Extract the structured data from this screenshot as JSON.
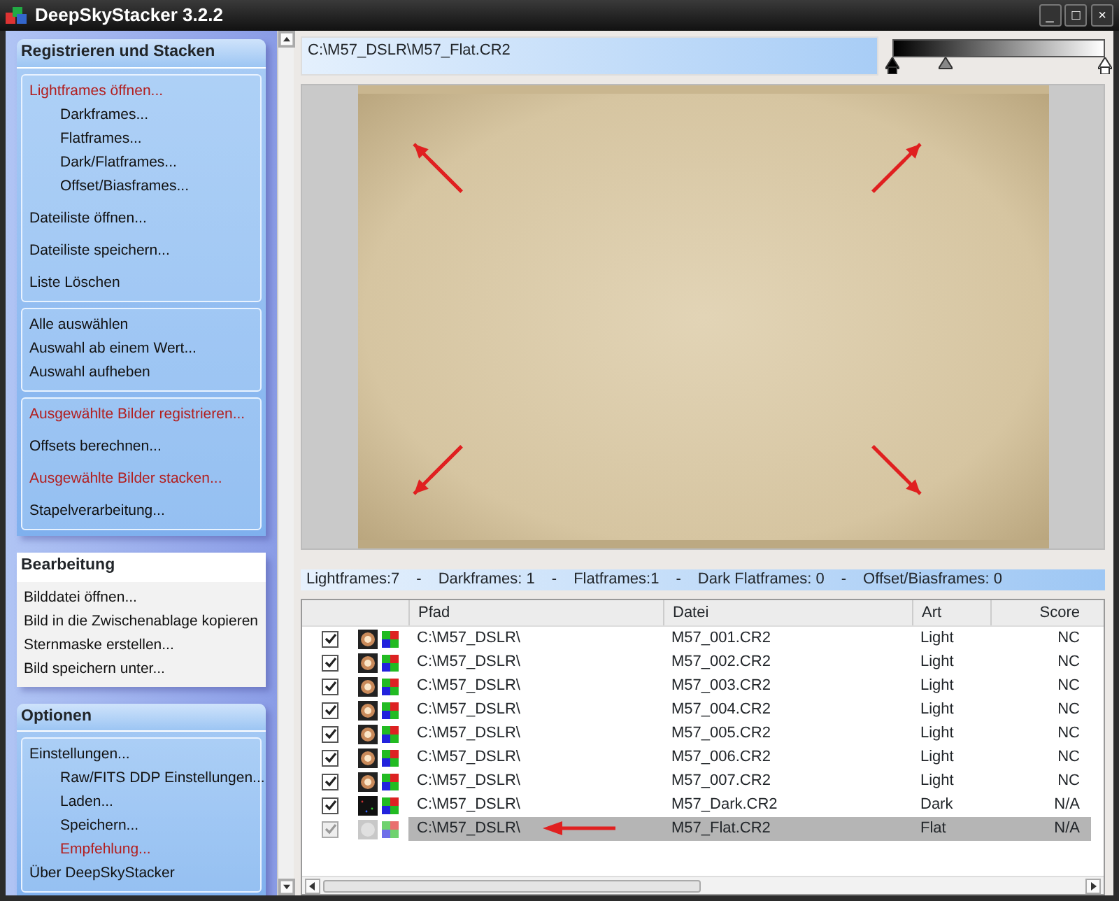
{
  "window": {
    "title": "DeepSkyStacker 3.2.2",
    "controls": [
      "_",
      "□",
      "×"
    ]
  },
  "sidebar": {
    "sections": [
      {
        "title": "Registrieren und Stacken",
        "kind": "blue",
        "boxes": [
          {
            "items": [
              {
                "label": "Lightframes öffnen...",
                "emphasis": true,
                "children": [
                  {
                    "label": "Darkframes...",
                    "emphasis": false
                  },
                  {
                    "label": "Flatframes...",
                    "emphasis": false
                  },
                  {
                    "label": "Dark/Flatframes...",
                    "emphasis": false
                  },
                  {
                    "label": "Offset/Biasframes...",
                    "emphasis": false
                  }
                ]
              },
              {
                "label": "Dateiliste öffnen...",
                "emphasis": false
              },
              {
                "label": "Dateiliste speichern...",
                "emphasis": false
              },
              {
                "label": "Liste Löschen",
                "emphasis": false
              }
            ]
          },
          {
            "items": [
              {
                "label": "Alle auswählen",
                "emphasis": false
              },
              {
                "label": "Auswahl ab einem Wert...",
                "emphasis": false
              },
              {
                "label": "Auswahl aufheben",
                "emphasis": false
              }
            ]
          },
          {
            "items": [
              {
                "label": "Ausgewählte Bilder registrieren...",
                "emphasis": true
              },
              {
                "label": "Offsets berechnen...",
                "emphasis": false
              },
              {
                "label": "Ausgewählte Bilder stacken...",
                "emphasis": true
              },
              {
                "label": "Stapelverarbeitung...",
                "emphasis": false
              }
            ]
          }
        ]
      },
      {
        "title": "Bearbeitung",
        "kind": "white",
        "boxes": [
          {
            "items": [
              {
                "label": "Bilddatei öffnen...",
                "emphasis": false
              },
              {
                "label": "Bild in die Zwischenablage kopieren",
                "emphasis": false
              },
              {
                "label": "Sternmaske erstellen...",
                "emphasis": false
              },
              {
                "label": "Bild speichern unter...",
                "emphasis": false
              }
            ]
          }
        ]
      },
      {
        "title": "Optionen",
        "kind": "blue",
        "boxes": [
          {
            "items": [
              {
                "label": "Einstellungen...",
                "emphasis": false,
                "children": [
                  {
                    "label": "Raw/FITS DDP Einstellungen...",
                    "emphasis": false
                  },
                  {
                    "label": "Laden...",
                    "emphasis": false
                  },
                  {
                    "label": "Speichern...",
                    "emphasis": false
                  },
                  {
                    "label": "Empfehlung...",
                    "emphasis": true
                  }
                ]
              },
              {
                "label": "Über DeepSkyStacker",
                "emphasis": false
              }
            ]
          }
        ]
      }
    ]
  },
  "file_path": "C:\\M57_DSLR\\M57_Flat.CR2",
  "histogram_sliders": [
    {
      "kind": "black",
      "level": 0
    },
    {
      "kind": "gray",
      "level": 0.25
    },
    {
      "kind": "white",
      "level": 1
    }
  ],
  "summary": [
    "Lightframes:7",
    "-",
    "Darkframes: 1",
    "-",
    "Flatframes:1",
    "-",
    "Dark Flatframes: 0",
    "-",
    "Offset/Biasframes: 0"
  ],
  "table": {
    "columns": [
      "Pfad",
      "Datei",
      "Art",
      "Score"
    ],
    "rows": [
      {
        "checked": true,
        "selected": false,
        "kind": "light",
        "cells": [
          "C:\\M57_DSLR\\",
          "M57_001.CR2",
          "Light",
          "NC"
        ]
      },
      {
        "checked": true,
        "selected": false,
        "kind": "light",
        "cells": [
          "C:\\M57_DSLR\\",
          "M57_002.CR2",
          "Light",
          "NC"
        ]
      },
      {
        "checked": true,
        "selected": false,
        "kind": "light",
        "cells": [
          "C:\\M57_DSLR\\",
          "M57_003.CR2",
          "Light",
          "NC"
        ]
      },
      {
        "checked": true,
        "selected": false,
        "kind": "light",
        "cells": [
          "C:\\M57_DSLR\\",
          "M57_004.CR2",
          "Light",
          "NC"
        ]
      },
      {
        "checked": true,
        "selected": false,
        "kind": "light",
        "cells": [
          "C:\\M57_DSLR\\",
          "M57_005.CR2",
          "Light",
          "NC"
        ]
      },
      {
        "checked": true,
        "selected": false,
        "kind": "light",
        "cells": [
          "C:\\M57_DSLR\\",
          "M57_006.CR2",
          "Light",
          "NC"
        ]
      },
      {
        "checked": true,
        "selected": false,
        "kind": "light",
        "cells": [
          "C:\\M57_DSLR\\",
          "M57_007.CR2",
          "Light",
          "NC"
        ]
      },
      {
        "checked": true,
        "selected": false,
        "kind": "dark",
        "cells": [
          "C:\\M57_DSLR\\",
          "M57_Dark.CR2",
          "Dark",
          "N/A"
        ]
      },
      {
        "checked": true,
        "selected": true,
        "kind": "flat",
        "cells": [
          "C:\\M57_DSLR\\",
          "M57_Flat.CR2",
          "Flat",
          "N/A"
        ]
      }
    ]
  }
}
